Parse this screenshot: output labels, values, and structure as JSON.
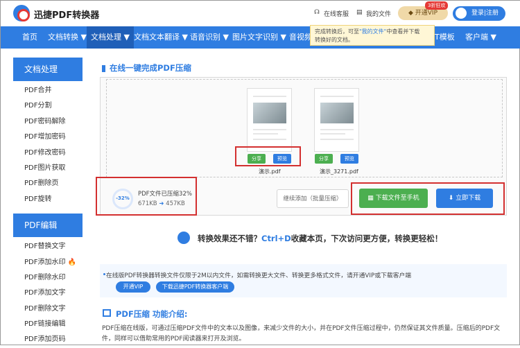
{
  "header": {
    "brand": "迅捷PDF转换器",
    "online_service": "在线客服",
    "my_files": "我的文件",
    "vip_label": "开通VIP",
    "vip_badge": "3折狂欢",
    "login_label": "登录|注册"
  },
  "nav": {
    "items": [
      "首页",
      "文档转换 ▼",
      "文档处理 ▼",
      "文档文本翻译 ▼",
      "语音识别 ▼",
      "图片文字识别 ▼",
      "音视频",
      "T模板",
      "客户端 ▼"
    ]
  },
  "tooltip": {
    "text_a": "完成转换后，可至",
    "text_link": "\"我的文件\"",
    "text_b": "中查看并下载",
    "text_c": "转换好的文档。"
  },
  "sidebar": {
    "section1": "文档处理",
    "items1": [
      "PDF合并",
      "PDF分割",
      "PDF密码解除",
      "PDF增加密码",
      "PDF修改密码",
      "PDF图片获取",
      "PDF删除页",
      "PDF旋转"
    ],
    "section2": "PDF编辑",
    "items2": [
      "PDF替换文字",
      "PDF添加水印",
      "PDF删除水印",
      "PDF添加文字",
      "PDF删除文字",
      "PDF链接编辑",
      "PDF添加页码"
    ]
  },
  "main": {
    "title": "在线一键完成PDF压缩",
    "files": [
      {
        "name": "演示.pdf",
        "share": "分享",
        "preview": "预览"
      },
      {
        "name": "演示_3271.pdf",
        "share": "分享",
        "preview": "预览"
      }
    ],
    "progress_pct": "-32%",
    "compress_status": "PDF文件已压缩32%",
    "size_before": "671KB",
    "size_arrow": "➜",
    "size_after": "457KB",
    "continue_label": "继续添加（批量压缩）",
    "download_phone": "下载文件至手机",
    "download_now": "立即下载",
    "promo_a": "转换效果还不错？",
    "promo_hl": "Ctrl+D",
    "promo_b": "收藏本页，下次访问更方便，转换更轻松！",
    "notice": "在线版PDF转换器转换文件仅限于2M以内文件，如需转换更大文件、转换更多格式文件，请开通VIP或下载客户端",
    "notice_vip": "开通VIP",
    "notice_client": "下载迅捷PDF转换器客户端",
    "intro_title": "PDF压缩 功能介绍:",
    "intro_body": "PDF压缩在线版，可通过压缩PDF文件中的文本以及图像，来减少文件的大小，并在PDF文件压缩过程中，仍然保证其文件质量。压缩后的PDF文件，同样可以借助常用的PDF阅读器来打开及浏览。"
  },
  "colors": {
    "accent": "#2f7de1",
    "green": "#4caf50",
    "highlight_border": "#d32f2f"
  }
}
